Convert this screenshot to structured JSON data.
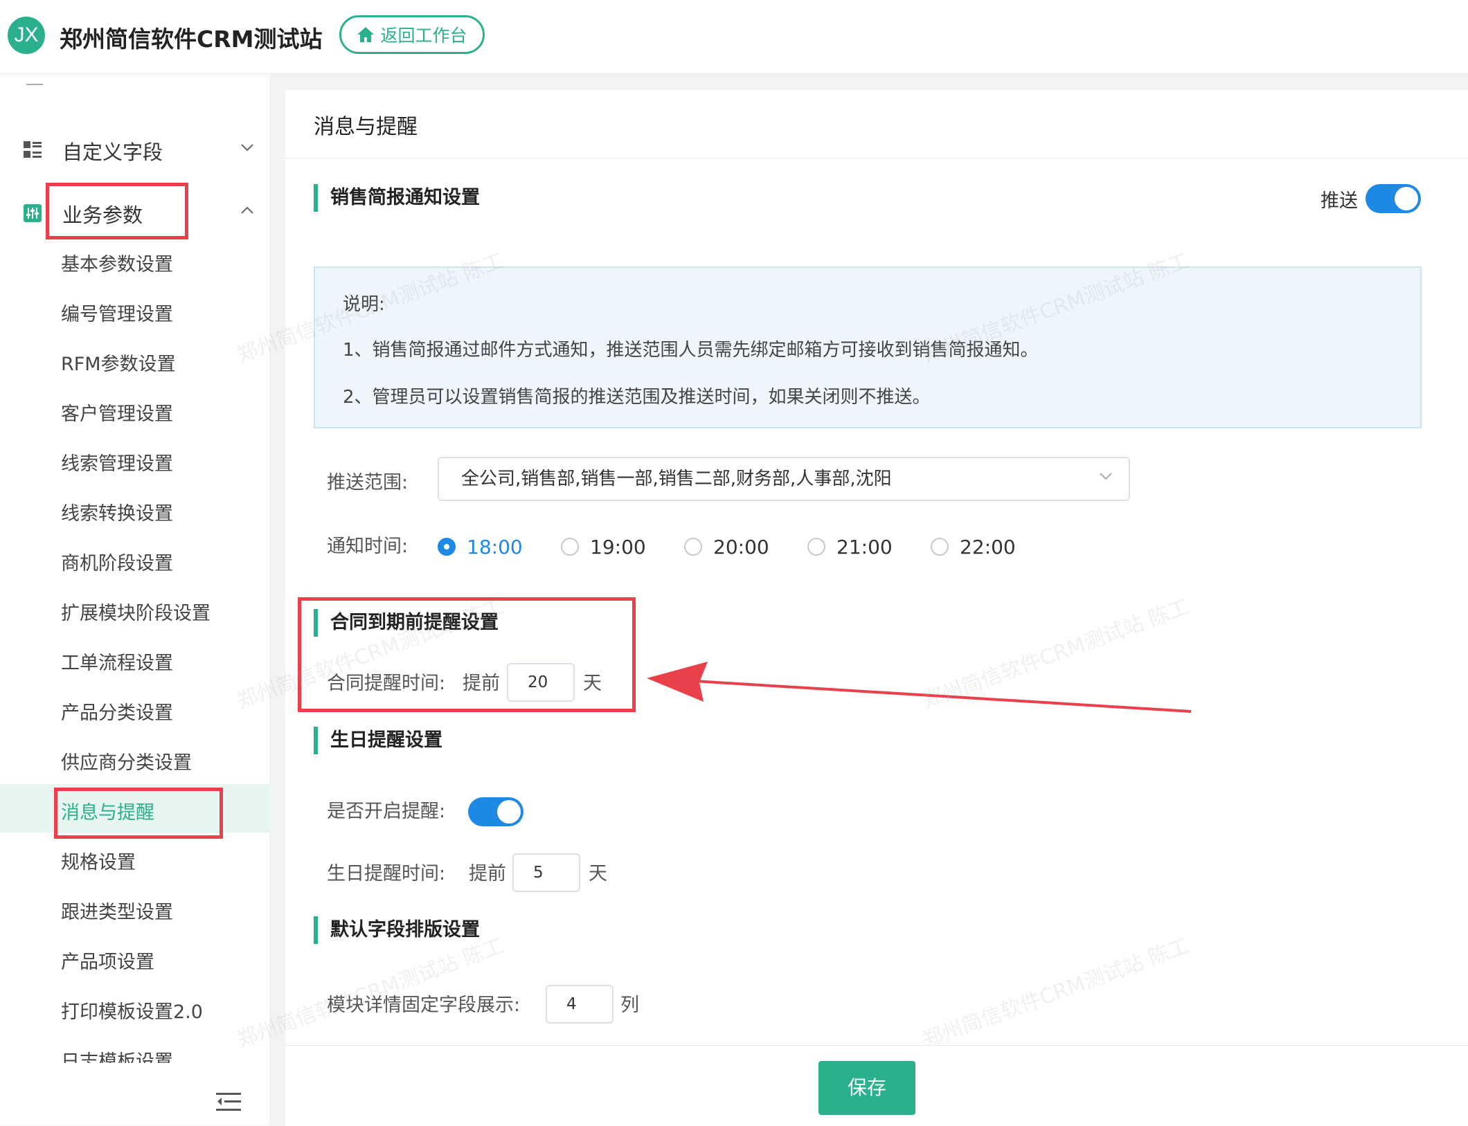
{
  "header": {
    "logo_text": "JX",
    "app_title": "郑州简信软件CRM测试站",
    "home_button": "返回工作台"
  },
  "sidebar": {
    "custom_fields": "自定义字段",
    "business_params": "业务参数",
    "items": [
      "基本参数设置",
      "编号管理设置",
      "RFM参数设置",
      "客户管理设置",
      "线索管理设置",
      "线索转换设置",
      "商机阶段设置",
      "扩展模块阶段设置",
      "工单流程设置",
      "产品分类设置",
      "供应商分类设置",
      "消息与提醒",
      "规格设置",
      "跟进类型设置",
      "产品项设置",
      "打印模板设置2.0",
      "日志模板设置"
    ],
    "active_item": "消息与提醒"
  },
  "main": {
    "page_title": "消息与提醒",
    "sales_report": {
      "title": "销售简报通知设置",
      "push_label": "推送",
      "push_enabled": true,
      "info_title": "说明:",
      "info_lines": [
        "1、销售简报通过邮件方式通知，推送范围人员需先绑定邮箱方可接收到销售简报通知。",
        "2、管理员可以设置销售简报的推送范围及推送时间，如果关闭则不推送。"
      ],
      "scope_label": "推送范围:",
      "scope_value": "全公司,销售部,销售一部,销售二部,财务部,人事部,沈阳",
      "time_label": "通知时间:",
      "time_options": [
        "18:00",
        "19:00",
        "20:00",
        "21:00",
        "22:00"
      ],
      "time_selected": "18:00"
    },
    "contract": {
      "title": "合同到期前提醒设置",
      "label": "合同提醒时间:",
      "prefix": "提前",
      "value": "20",
      "unit": "天"
    },
    "birthday": {
      "title": "生日提醒设置",
      "enable_label": "是否开启提醒:",
      "enabled": true,
      "time_label": "生日提醒时间:",
      "prefix": "提前",
      "value": "5",
      "unit": "天"
    },
    "layout": {
      "title": "默认字段排版设置",
      "label": "模块详情固定字段展示:",
      "value": "4",
      "unit": "列"
    },
    "save_button": "保存"
  },
  "watermark": "郑州简信软件CRM测试站 陈工",
  "colors": {
    "brand": "#2bb08e",
    "accent_blue": "#1e88e5",
    "highlight_red": "#e8414c"
  }
}
